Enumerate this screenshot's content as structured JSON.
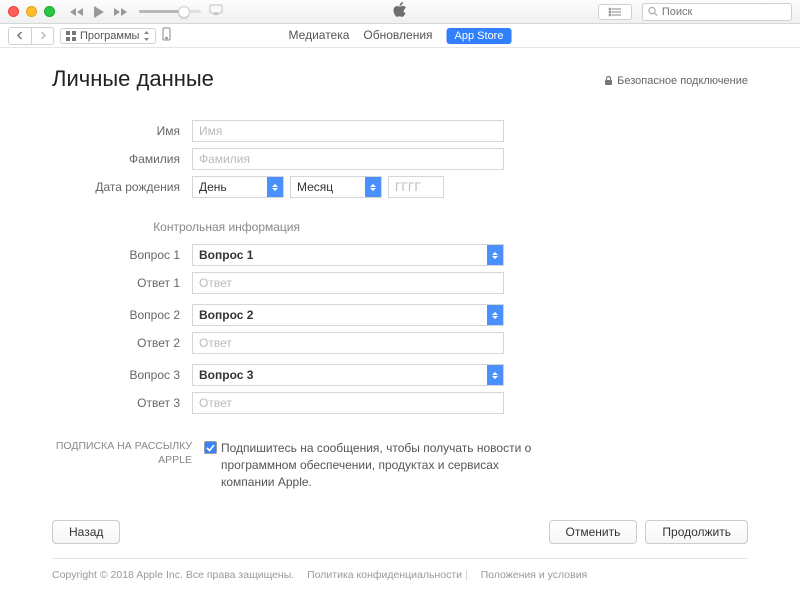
{
  "search_placeholder": "Поиск",
  "library_dropdown": "Программы",
  "tabs": {
    "library": "Медиатека",
    "updates": "Обновления",
    "appstore": "App Store"
  },
  "page": {
    "title": "Личные данные",
    "secure": "Безопасное подключение"
  },
  "form": {
    "name_label": "Имя",
    "name_placeholder": "Имя",
    "surname_label": "Фамилия",
    "surname_placeholder": "Фамилия",
    "birth_label": "Дата рождения",
    "day": "День",
    "month": "Месяц",
    "year_placeholder": "ГГГГ",
    "security_section": "Контрольная информация",
    "q1_label": "Вопрос 1",
    "q1_value": "Вопрос 1",
    "a1_label": "Ответ 1",
    "a1_placeholder": "Ответ",
    "q2_label": "Вопрос 2",
    "q2_value": "Вопрос 2",
    "a2_label": "Ответ 2",
    "a2_placeholder": "Ответ",
    "q3_label": "Вопрос 3",
    "q3_value": "Вопрос 3",
    "a3_label": "Ответ 3",
    "a3_placeholder": "Ответ"
  },
  "subscribe": {
    "label": "ПОДПИСКА НА РАССЫЛКУ APPLE",
    "text": "Подпишитесь на сообщения, чтобы получать новости о программном обеспечении, продуктах и сервисах компании Apple.",
    "checked": true
  },
  "buttons": {
    "back": "Назад",
    "cancel": "Отменить",
    "continue": "Продолжить"
  },
  "footer": {
    "copyright": "Copyright © 2018 Apple Inc. Все права защищены.",
    "privacy": "Политика конфиденциальности",
    "terms": "Положения и условия"
  }
}
